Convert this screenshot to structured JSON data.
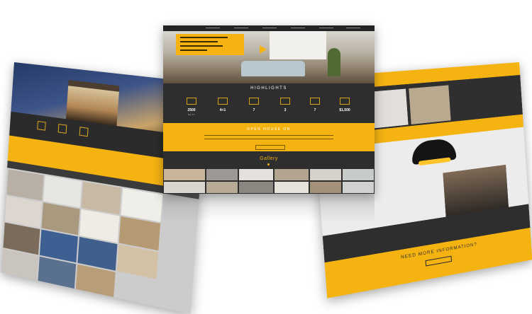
{
  "colors": {
    "accent": "#f5b312",
    "dark": "#2f2f30",
    "background": "#ffffff"
  },
  "center": {
    "highlights_title": "HIGHLIGHTS",
    "highlights": [
      {
        "icon": "area-icon",
        "value": "2500",
        "label": "SQ FT"
      },
      {
        "icon": "car-icon",
        "value": "4+1",
        "label": ""
      },
      {
        "icon": "bed-icon",
        "value": "7",
        "label": ""
      },
      {
        "icon": "bath-icon",
        "value": "3",
        "label": ""
      },
      {
        "icon": "garage-icon",
        "value": "7",
        "label": ""
      },
      {
        "icon": "price-icon",
        "value": "$1,500",
        "label": ""
      }
    ],
    "open_house_title": "OPEN HOUSE ON",
    "gallery_title": "Gallery"
  },
  "right": {
    "need_info": "NEED MORE INFORMATION?"
  }
}
